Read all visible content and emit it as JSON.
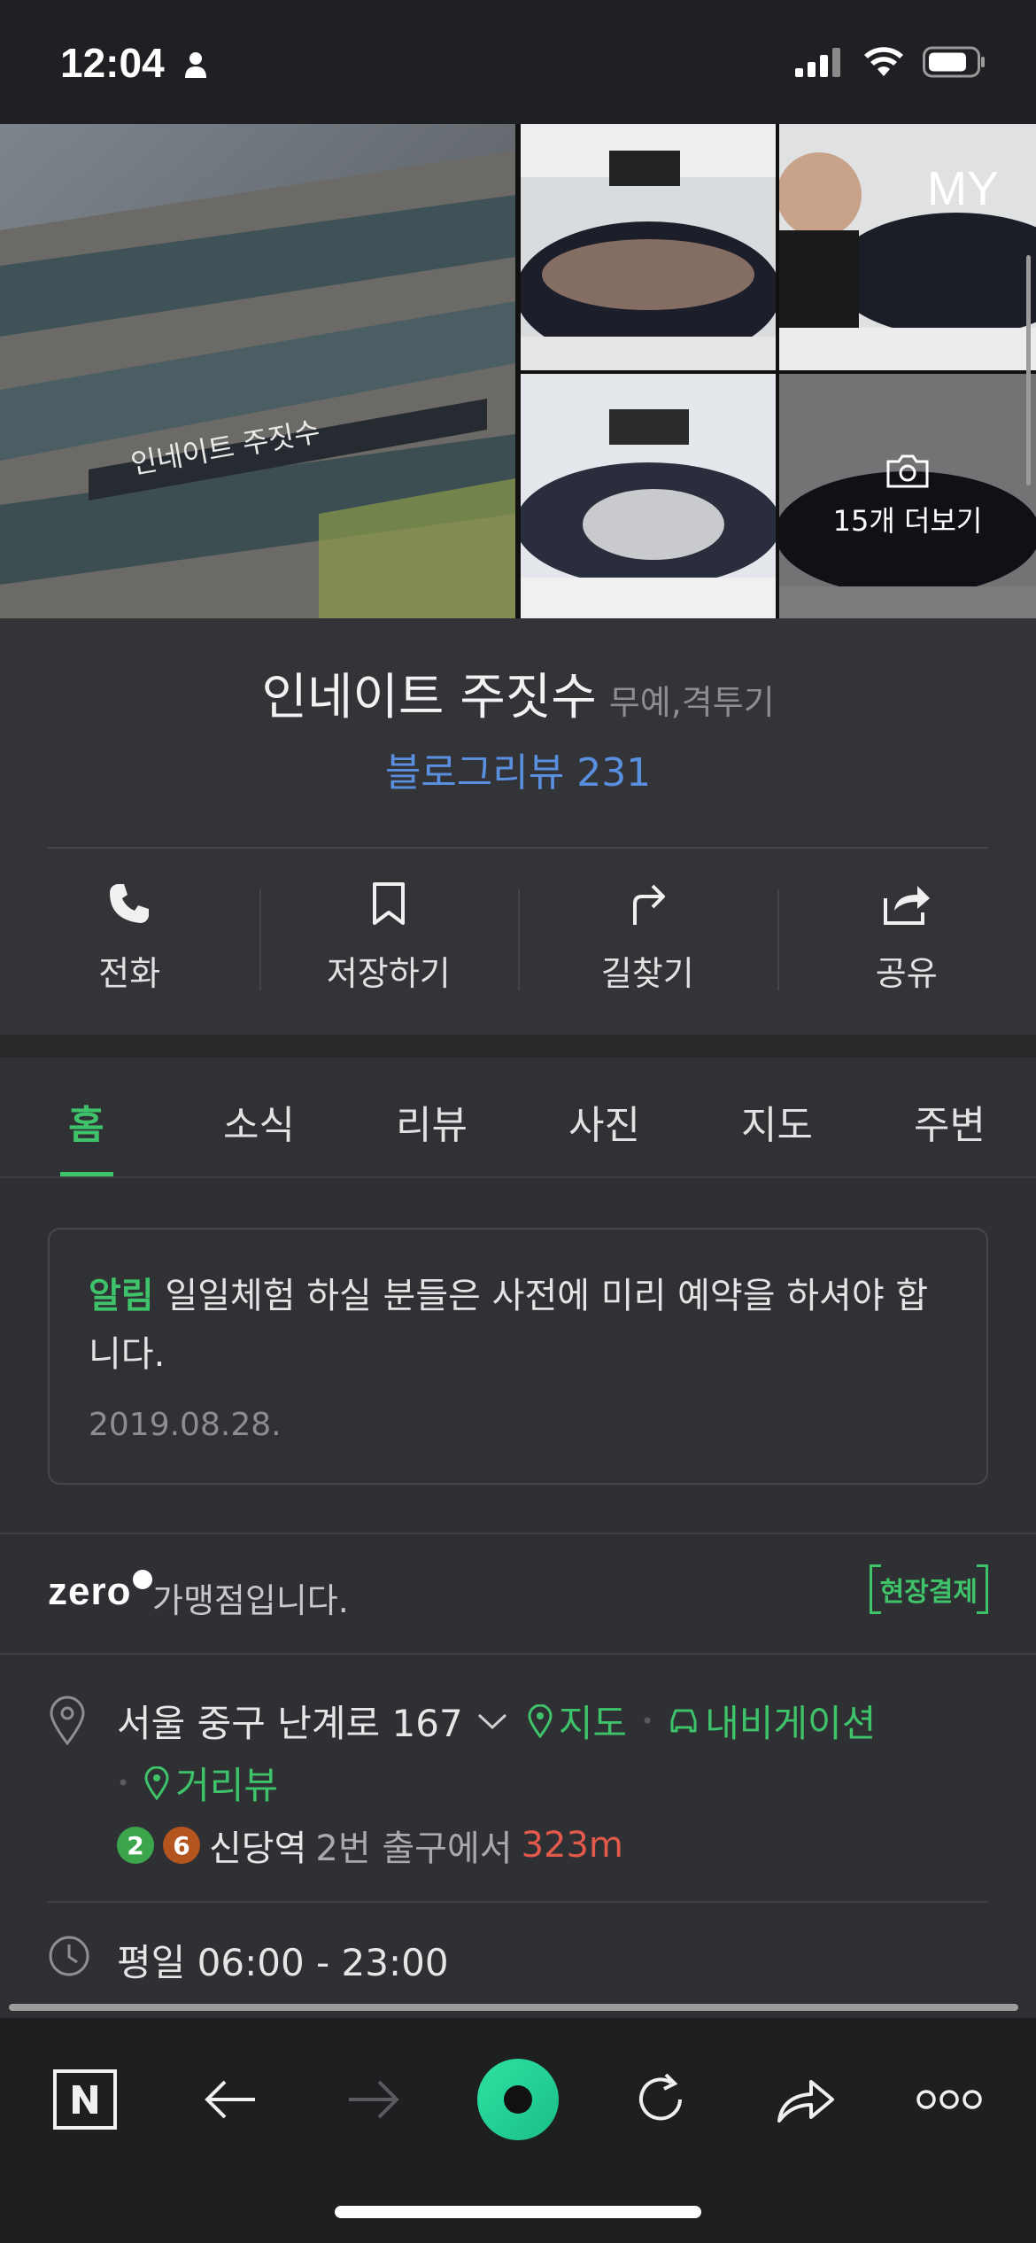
{
  "status_bar": {
    "time": "12:04"
  },
  "photos": {
    "sign_text": "인네이트 주짓수",
    "my_badge": "MY",
    "more_label": "15개 더보기"
  },
  "place": {
    "name": "인네이트 주짓수",
    "category": "무예,격투기",
    "blog_review": "블로그리뷰 231"
  },
  "actions": [
    {
      "label": "전화",
      "icon": "phone-icon"
    },
    {
      "label": "저장하기",
      "icon": "bookmark-icon"
    },
    {
      "label": "길찾기",
      "icon": "directions-icon"
    },
    {
      "label": "공유",
      "icon": "share-icon"
    }
  ],
  "tabs": [
    {
      "label": "홈",
      "active": true
    },
    {
      "label": "소식"
    },
    {
      "label": "리뷰"
    },
    {
      "label": "사진"
    },
    {
      "label": "지도"
    },
    {
      "label": "주변"
    }
  ],
  "notice": {
    "tag": "알림",
    "text": "일일체험 하실 분들은 사전에 미리 예약을 하셔야 합니다.",
    "date": "2019.08.28."
  },
  "zeropay": {
    "logo": "zero",
    "text": "가맹점입니다.",
    "badge": "현장결제"
  },
  "address": {
    "text": "서울 중구 난계로 167",
    "map_link": "지도",
    "nav_link": "내비게이션",
    "street_link": "거리뷰"
  },
  "subway": {
    "lines": [
      {
        "number": "2",
        "color": "#3aa54a"
      },
      {
        "number": "6",
        "color": "#b4541f"
      }
    ],
    "station": "신당역",
    "exit": "2번 출구에서",
    "distance": "323m"
  },
  "hours": {
    "text": "평일 06:00 - 23:00"
  },
  "colors": {
    "accent_green": "#3ec26a",
    "blue_link": "#5a8fe0",
    "distance_red": "#e25a4b"
  }
}
